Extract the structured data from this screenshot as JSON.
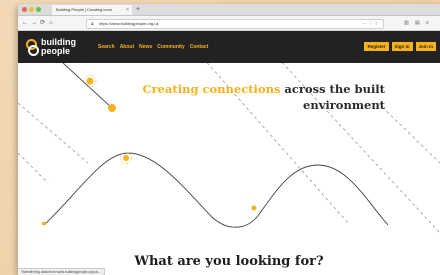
{
  "browser": {
    "tab_title": "Building People | Creating conn",
    "tab_close": "×",
    "new_tab": "+",
    "back": "←",
    "forward": "→",
    "reload": "⟳",
    "home": "⌂",
    "url": "https://www.buildingpeople.org.uk",
    "url_actions": "··· ♡ ☆",
    "library": "▥",
    "sidebar": "▤",
    "menu": "≡"
  },
  "site": {
    "logo_line1": "building",
    "logo_line2": "people",
    "nav": [
      "Search",
      "About",
      "News",
      "Community",
      "Contact"
    ],
    "auth": [
      "Register",
      "Sign In",
      "Join In"
    ],
    "headline_accent": "Creating connections",
    "headline_rest1": " across the built",
    "headline_rest2": "environment",
    "section_title": "What are you looking for?",
    "status_text": "Transferring data from www.buildingpeople.org.uk..."
  },
  "colors": {
    "accent": "#f6b11c",
    "header_bg": "#222222"
  }
}
